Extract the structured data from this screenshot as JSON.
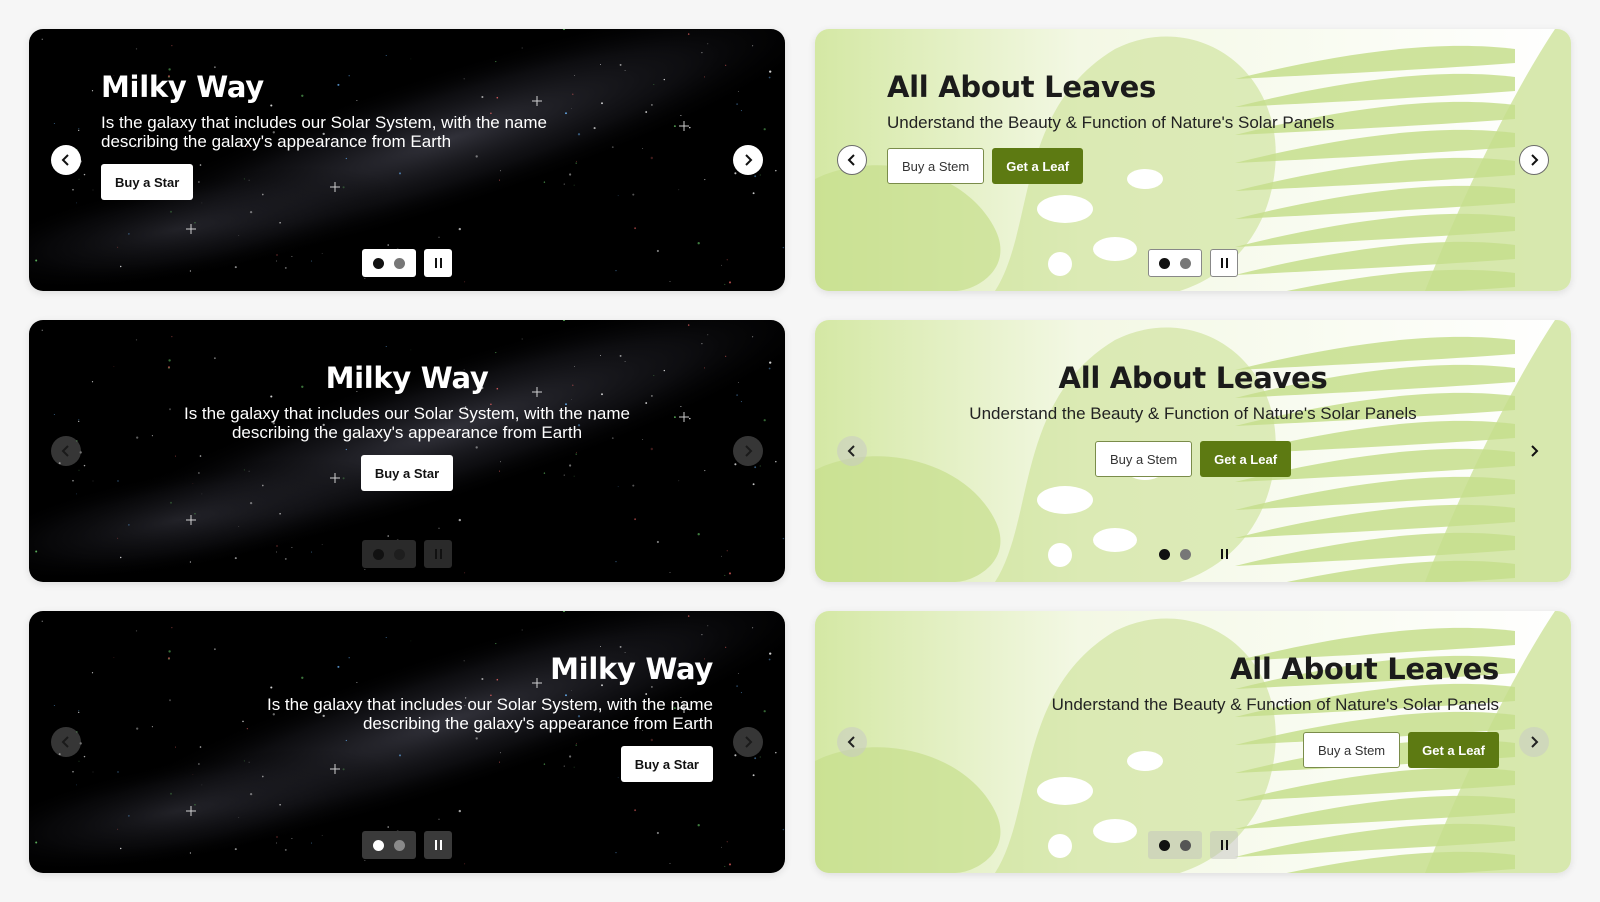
{
  "colors": {
    "page_bg": "#f6f6f6",
    "space_bg": "#000000",
    "leaf_bg": "#fbfdf6",
    "leaf_green": "#5d7a12",
    "leaf_shape": "#c5de8a"
  },
  "icons": {
    "prev": "chevron-left-icon",
    "next": "chevron-right-icon",
    "pause": "pause-icon"
  },
  "carousels": [
    {
      "title": "Milky Way",
      "description": "Is the galaxy that includes our Solar System, with the name describing the galaxy's appearance from Earth",
      "buttons": [
        {
          "label": "Buy a Star"
        }
      ],
      "slides": 2,
      "active_slide": 1,
      "theme": "space",
      "align": "left"
    },
    {
      "title": "All About Leaves",
      "description": "Understand the Beauty & Function of Nature's Solar Panels",
      "buttons": [
        {
          "label": "Buy a Stem"
        },
        {
          "label": "Get a Leaf"
        }
      ],
      "slides": 2,
      "active_slide": 1,
      "theme": "leaf",
      "align": "left"
    },
    {
      "title": "Milky Way",
      "description": "Is the galaxy that includes our Solar System, with the name describing the galaxy's appearance from Earth",
      "buttons": [
        {
          "label": "Buy a Star"
        }
      ],
      "slides": 2,
      "active_slide": 1,
      "theme": "space",
      "align": "center"
    },
    {
      "title": "All About Leaves",
      "description": "Understand the Beauty & Function of Nature's Solar Panels",
      "buttons": [
        {
          "label": "Buy a Stem"
        },
        {
          "label": "Get a Leaf"
        }
      ],
      "slides": 2,
      "active_slide": 1,
      "theme": "leaf",
      "align": "center"
    },
    {
      "title": "Milky Way",
      "description": "Is the galaxy that includes our Solar System, with the name describing the galaxy's appearance from Earth",
      "buttons": [
        {
          "label": "Buy a Star"
        }
      ],
      "slides": 2,
      "active_slide": 1,
      "theme": "space",
      "align": "right"
    },
    {
      "title": "All About Leaves",
      "description": "Understand the Beauty & Function of Nature's Solar Panels",
      "buttons": [
        {
          "label": "Buy a Stem"
        },
        {
          "label": "Get a Leaf"
        }
      ],
      "slides": 2,
      "active_slide": 1,
      "theme": "leaf",
      "align": "right"
    }
  ]
}
